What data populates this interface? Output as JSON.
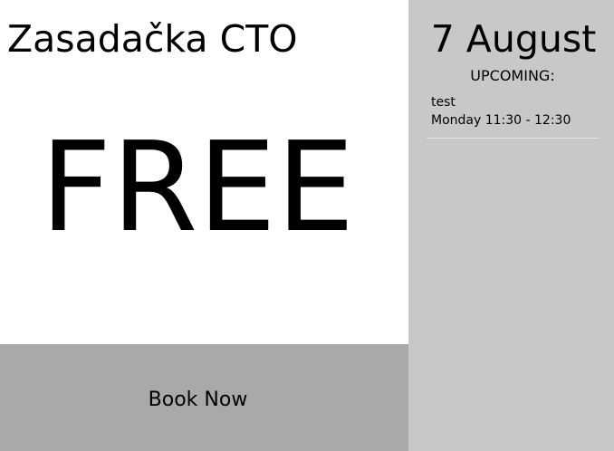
{
  "room": {
    "name": "Zasadačka CTO",
    "status": "FREE"
  },
  "booking": {
    "button_label": "Book Now"
  },
  "sidebar": {
    "date": "7 August",
    "upcoming_label": "UPCOMING:",
    "events": [
      {
        "title": "test",
        "time": "Monday 11:30 - 12:30"
      }
    ]
  },
  "colors": {
    "left_panel_bg": "#ffffff",
    "book_button_bg": "#a9a9a9",
    "sidebar_bg": "#c8c8c8",
    "event_divider": "#e6e6e6"
  }
}
